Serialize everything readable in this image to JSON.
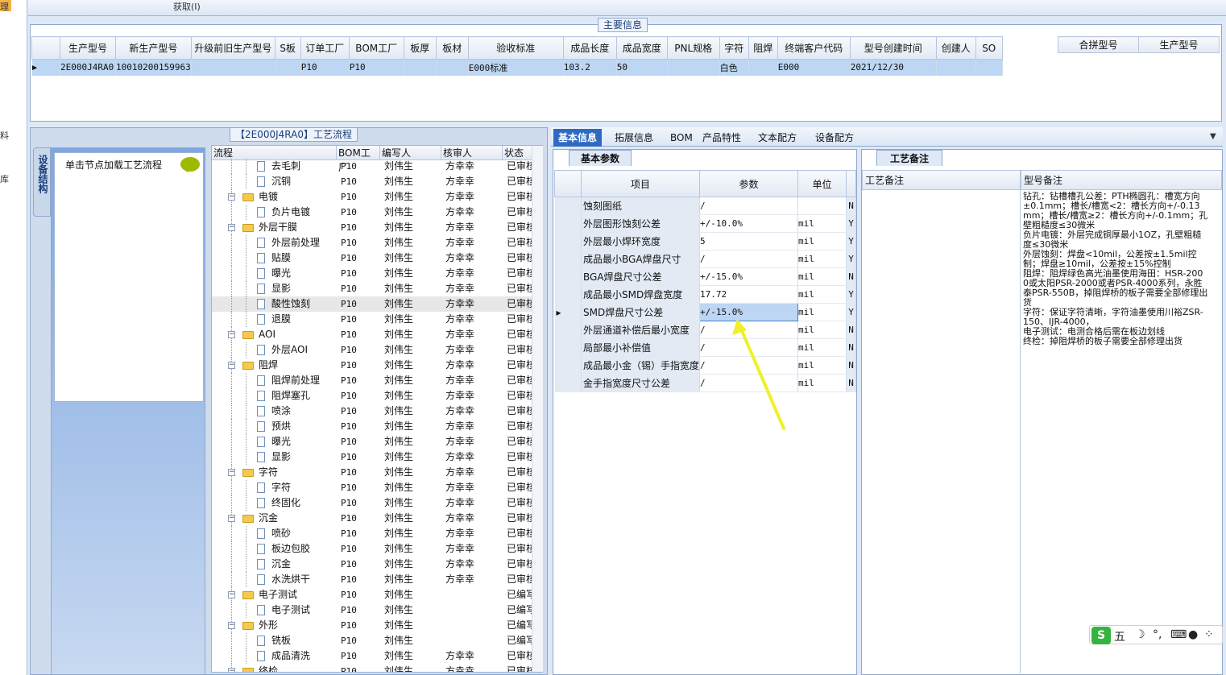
{
  "left_strip": {
    "chars": [
      "理",
      "料",
      "库"
    ]
  },
  "topbar": {
    "text": "获取(I)"
  },
  "main_info": {
    "title": "主要信息",
    "columns": [
      "生产型号",
      "新生产型号",
      "升级前旧生产型号",
      "S板",
      "订单工厂",
      "BOM工厂",
      "板厚",
      "板材",
      "验收标准",
      "成品长度",
      "成品宽度",
      "PNL规格",
      "字符",
      "阻焊",
      "终端客户代码",
      "型号创建时间",
      "创建人",
      "SO"
    ],
    "row": [
      "2E000J4RA0",
      "10010200159963",
      "",
      "",
      "P10",
      "P10",
      "",
      "",
      "E000标准",
      "103.2",
      "50",
      "",
      "白色",
      "",
      "E000",
      "2021/12/30",
      "",
      ""
    ],
    "merge_columns": [
      "合拼型号",
      "生产型号"
    ]
  },
  "process": {
    "title": "【2E000J4RA0】工艺流程",
    "side_tab": "设备结构",
    "node_hint": "单击节点加载工艺流程",
    "columns": [
      "流程",
      "BOM工厂",
      "编写人",
      "核审人",
      "状态"
    ],
    "rows": [
      {
        "name": "去毛刺",
        "level": 2,
        "bom": "P10",
        "writer": "刘伟生",
        "reviewer": "方幸幸",
        "status": "已审核"
      },
      {
        "name": "沉铜",
        "level": 2,
        "bom": "P10",
        "writer": "刘伟生",
        "reviewer": "方幸幸",
        "status": "已审核"
      },
      {
        "name": "电镀",
        "level": 1,
        "bom": "P10",
        "writer": "刘伟生",
        "reviewer": "方幸幸",
        "status": "已审核"
      },
      {
        "name": "负片电镀",
        "level": 2,
        "bom": "P10",
        "writer": "刘伟生",
        "reviewer": "方幸幸",
        "status": "已审核"
      },
      {
        "name": "外层干膜",
        "level": 1,
        "bom": "P10",
        "writer": "刘伟生",
        "reviewer": "方幸幸",
        "status": "已审核"
      },
      {
        "name": "外层前处理",
        "level": 2,
        "bom": "P10",
        "writer": "刘伟生",
        "reviewer": "方幸幸",
        "status": "已审核"
      },
      {
        "name": "贴膜",
        "level": 2,
        "bom": "P10",
        "writer": "刘伟生",
        "reviewer": "方幸幸",
        "status": "已审核"
      },
      {
        "name": "曝光",
        "level": 2,
        "bom": "P10",
        "writer": "刘伟生",
        "reviewer": "方幸幸",
        "status": "已审核"
      },
      {
        "name": "显影",
        "level": 2,
        "bom": "P10",
        "writer": "刘伟生",
        "reviewer": "方幸幸",
        "status": "已审核"
      },
      {
        "name": "酸性蚀刻",
        "level": 2,
        "bom": "P10",
        "writer": "刘伟生",
        "reviewer": "方幸幸",
        "status": "已审核",
        "highlight": true
      },
      {
        "name": "退膜",
        "level": 2,
        "bom": "P10",
        "writer": "刘伟生",
        "reviewer": "方幸幸",
        "status": "已审核"
      },
      {
        "name": "AOI",
        "level": 1,
        "bom": "P10",
        "writer": "刘伟生",
        "reviewer": "方幸幸",
        "status": "已审核"
      },
      {
        "name": "外层AOI",
        "level": 2,
        "bom": "P10",
        "writer": "刘伟生",
        "reviewer": "方幸幸",
        "status": "已审核"
      },
      {
        "name": "阻焊",
        "level": 1,
        "bom": "P10",
        "writer": "刘伟生",
        "reviewer": "方幸幸",
        "status": "已审核"
      },
      {
        "name": "阻焊前处理",
        "level": 2,
        "bom": "P10",
        "writer": "刘伟生",
        "reviewer": "方幸幸",
        "status": "已审核"
      },
      {
        "name": "阻焊塞孔",
        "level": 2,
        "bom": "P10",
        "writer": "刘伟生",
        "reviewer": "方幸幸",
        "status": "已审核"
      },
      {
        "name": "喷涂",
        "level": 2,
        "bom": "P10",
        "writer": "刘伟生",
        "reviewer": "方幸幸",
        "status": "已审核"
      },
      {
        "name": "预烘",
        "level": 2,
        "bom": "P10",
        "writer": "刘伟生",
        "reviewer": "方幸幸",
        "status": "已审核"
      },
      {
        "name": "曝光",
        "level": 2,
        "bom": "P10",
        "writer": "刘伟生",
        "reviewer": "方幸幸",
        "status": "已审核"
      },
      {
        "name": "显影",
        "level": 2,
        "bom": "P10",
        "writer": "刘伟生",
        "reviewer": "方幸幸",
        "status": "已审核"
      },
      {
        "name": "字符",
        "level": 1,
        "bom": "P10",
        "writer": "刘伟生",
        "reviewer": "方幸幸",
        "status": "已审核"
      },
      {
        "name": "字符",
        "level": 2,
        "bom": "P10",
        "writer": "刘伟生",
        "reviewer": "方幸幸",
        "status": "已审核"
      },
      {
        "name": "终固化",
        "level": 2,
        "bom": "P10",
        "writer": "刘伟生",
        "reviewer": "方幸幸",
        "status": "已审核"
      },
      {
        "name": "沉金",
        "level": 1,
        "bom": "P10",
        "writer": "刘伟生",
        "reviewer": "方幸幸",
        "status": "已审核"
      },
      {
        "name": "喷砂",
        "level": 2,
        "bom": "P10",
        "writer": "刘伟生",
        "reviewer": "方幸幸",
        "status": "已审核"
      },
      {
        "name": "板边包胶",
        "level": 2,
        "bom": "P10",
        "writer": "刘伟生",
        "reviewer": "方幸幸",
        "status": "已审核"
      },
      {
        "name": "沉金",
        "level": 2,
        "bom": "P10",
        "writer": "刘伟生",
        "reviewer": "方幸幸",
        "status": "已审核"
      },
      {
        "name": "水洗烘干",
        "level": 2,
        "bom": "P10",
        "writer": "刘伟生",
        "reviewer": "方幸幸",
        "status": "已审核"
      },
      {
        "name": "电子测试",
        "level": 1,
        "bom": "P10",
        "writer": "刘伟生",
        "reviewer": "",
        "status": "已编写"
      },
      {
        "name": "电子测试",
        "level": 2,
        "bom": "P10",
        "writer": "刘伟生",
        "reviewer": "",
        "status": "已编写"
      },
      {
        "name": "外形",
        "level": 1,
        "bom": "P10",
        "writer": "刘伟生",
        "reviewer": "",
        "status": "已编写"
      },
      {
        "name": "铣板",
        "level": 2,
        "bom": "P10",
        "writer": "刘伟生",
        "reviewer": "",
        "status": "已编写"
      },
      {
        "name": "成品清洗",
        "level": 2,
        "bom": "P10",
        "writer": "刘伟生",
        "reviewer": "方幸幸",
        "status": "已审核"
      },
      {
        "name": "终检",
        "level": 1,
        "bom": "P10",
        "writer": "刘伟生",
        "reviewer": "方幸幸",
        "status": "已审核"
      }
    ]
  },
  "tabs": [
    "基本信息",
    "拓展信息",
    "BOM",
    "产品特性",
    "文本配方",
    "设备配方"
  ],
  "params": {
    "title": "基本参数",
    "columns": [
      "项目",
      "参数",
      "单位"
    ],
    "rows": [
      {
        "item": "蚀刻图纸",
        "value": "/",
        "unit": "",
        "flag": "N"
      },
      {
        "item": "外层图形蚀刻公差",
        "value": "+/-10.0%",
        "unit": "mil",
        "flag": "Y"
      },
      {
        "item": "外层最小焊环宽度",
        "value": "5",
        "unit": "mil",
        "flag": "Y"
      },
      {
        "item": "成品最小BGA焊盘尺寸",
        "value": "/",
        "unit": "mil",
        "flag": "Y"
      },
      {
        "item": "BGA焊盘尺寸公差",
        "value": "+/-15.0%",
        "unit": "mil",
        "flag": "N"
      },
      {
        "item": "成品最小SMD焊盘宽度",
        "value": "17.72",
        "unit": "mil",
        "flag": "Y"
      },
      {
        "item": "SMD焊盘尺寸公差",
        "value": "+/-15.0%",
        "unit": "mil",
        "flag": "Y",
        "selected": true
      },
      {
        "item": "外层通道补偿后最小宽度",
        "value": "/",
        "unit": "mil",
        "flag": "N"
      },
      {
        "item": "局部最小补偿值",
        "value": "/",
        "unit": "mil",
        "flag": "N"
      },
      {
        "item": "成品最小金（锡）手指宽度",
        "value": "/",
        "unit": "mil",
        "flag": "N"
      },
      {
        "item": "金手指宽度尺寸公差",
        "value": "/",
        "unit": "mil",
        "flag": "N"
      }
    ]
  },
  "notes": {
    "title": "工艺备注",
    "col1": "工艺备注",
    "col2": "型号备注",
    "text": "钻孔：钻槽槽孔公差：PTH椭圆孔：槽宽方向±0.1mm；槽长/槽宽<2：槽长方向+/-0.13mm；槽长/槽宽≥2：槽长方向+/-0.1mm；孔壁粗糙度≤30微米\n负片电镀：外层完成铜厚最小1OZ，孔壁粗糙度≤30微米\n外层蚀刻：焊盘<10mil，公差按±1.5mil控制；焊盘≥10mil，公差按±15%控制\n阻焊：阻焊绿色高光油墨使用海田：HSR-2000或太阳PSR-2000或者PSR-4000系列，永胜泰PSR-550B，掉阻焊桥的板子需要全部修理出货\n字符：保证字符清晰，字符油墨使用川裕ZSR-150、IJR-4000，\n电子测试：电测合格后需在板边划线\n终检：掉阻焊桥的板子需要全部修理出货"
  },
  "ime": {
    "label": "五"
  }
}
